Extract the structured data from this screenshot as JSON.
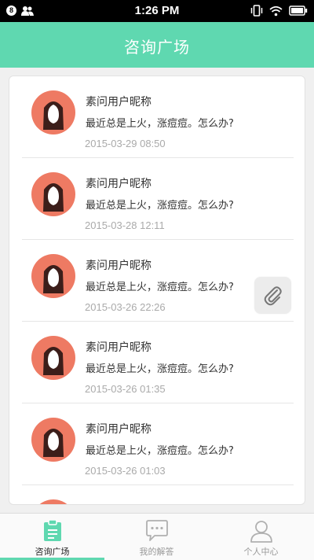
{
  "status_bar": {
    "time": "1:26 PM",
    "notification_badge": "8",
    "icons": [
      "notification-badge-icon",
      "contacts-icon",
      "vibrate-icon",
      "wifi-icon",
      "battery-icon"
    ]
  },
  "header": {
    "title": "咨询广场"
  },
  "colors": {
    "accent": "#5fd8b0",
    "avatar_bg": "#ee7a63"
  },
  "consultations": [
    {
      "nickname": "素问用户昵称",
      "question": "最近总是上火，涨痘痘。怎么办?",
      "date": "2015-03-29 08:50"
    },
    {
      "nickname": "素问用户昵称",
      "question": "最近总是上火，涨痘痘。怎么办?",
      "date": "2015-03-28 12:11"
    },
    {
      "nickname": "素问用户昵称",
      "question": "最近总是上火，涨痘痘。怎么办?",
      "date": "2015-03-26 22:26"
    },
    {
      "nickname": "素问用户昵称",
      "question": "最近总是上火，涨痘痘。怎么办?",
      "date": "2015-03-26 01:35"
    },
    {
      "nickname": "素问用户昵称",
      "question": "最近总是上火，涨痘痘。怎么办?",
      "date": "2015-03-26 01:03"
    }
  ],
  "floating_button": {
    "icon": "paperclip-icon"
  },
  "tabs": [
    {
      "label": "咨询广场",
      "icon": "clipboard-icon",
      "active": true
    },
    {
      "label": "我的解答",
      "icon": "chat-bubble-icon",
      "active": false
    },
    {
      "label": "个人中心",
      "icon": "person-icon",
      "active": false
    }
  ]
}
